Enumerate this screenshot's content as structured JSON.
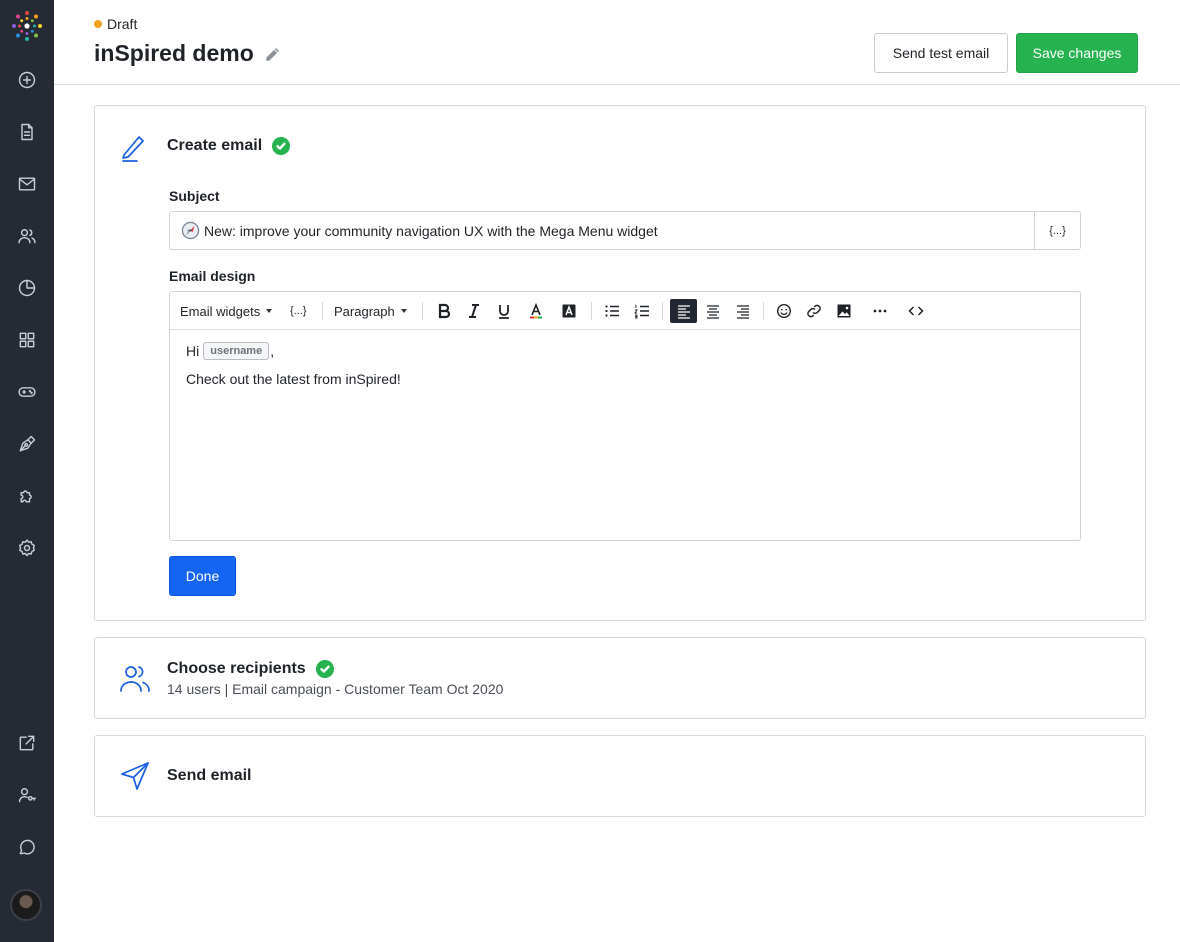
{
  "header": {
    "status": "Draft",
    "title": "inSpired demo",
    "send_test_label": "Send test email",
    "save_label": "Save changes"
  },
  "sidebar": {
    "items": [
      {
        "icon": "plus-circle-icon"
      },
      {
        "icon": "document-icon"
      },
      {
        "icon": "mail-icon"
      },
      {
        "icon": "users-icon"
      },
      {
        "icon": "pie-chart-icon"
      },
      {
        "icon": "grid-icon"
      },
      {
        "icon": "gamepad-icon"
      },
      {
        "icon": "pen-tool-icon"
      },
      {
        "icon": "puzzle-icon"
      },
      {
        "icon": "gear-icon"
      }
    ],
    "bottom_items": [
      {
        "icon": "external-link-icon"
      },
      {
        "icon": "user-key-icon"
      },
      {
        "icon": "chat-icon"
      }
    ]
  },
  "create_email": {
    "title": "Create email",
    "subject_label": "Subject",
    "subject_value": "New: improve your community navigation UX with the Mega Menu widget",
    "variable_button": "{...}",
    "design_label": "Email design",
    "toolbar": {
      "email_widgets": "Email widgets",
      "variables": "{...}",
      "paragraph": "Paragraph"
    },
    "body_greeting": "Hi",
    "body_tag": "username",
    "body_comma": ",",
    "body_line2": "Check out the latest from inSpired!",
    "done_label": "Done"
  },
  "recipients": {
    "title": "Choose recipients",
    "summary": "14 users | Email campaign - Customer Team Oct 2020"
  },
  "send": {
    "title": "Send email"
  },
  "colors": {
    "sidebar": "#262a35",
    "accent_green": "#26b24f",
    "accent_blue": "#1565f5",
    "icon_blue": "#1a5fe0",
    "draft_dot": "#f0a020"
  }
}
